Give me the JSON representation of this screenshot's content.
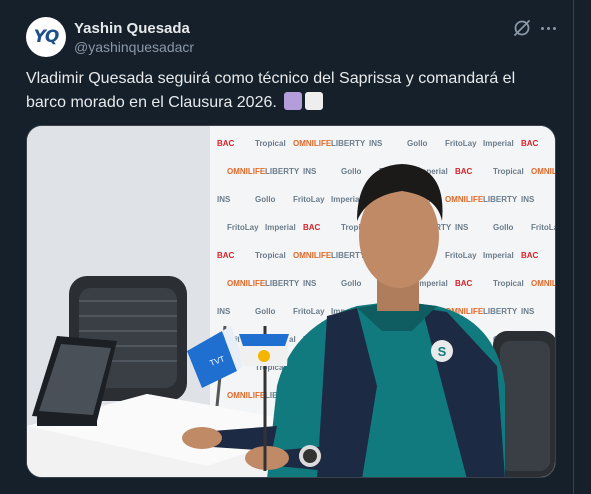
{
  "author": {
    "name": "Yashin Quesada",
    "handle": "@yashinquesadacr",
    "avatar_text": "YQ"
  },
  "actions": {
    "grok_icon": "grok-icon",
    "more_icon": "more-icon"
  },
  "tweet": {
    "text": "Vladimir Quesada seguirá como técnico del Saprissa y comandará el barco morado en el Clausura 2026.",
    "emoji": [
      "purple-square",
      "white-square"
    ]
  },
  "media": {
    "backdrop_sponsors": [
      "BAC",
      "Tropical",
      "OMNILIFE",
      "LIBERTY",
      "INS",
      "Gollo",
      "FritoLay",
      "Imperial"
    ],
    "microphone_brands": [
      "Teletica",
      "Teletica"
    ],
    "colors": {
      "accent_purple": "#b39ddb",
      "jersey_teal": "#117a7e",
      "jersey_navy": "#1d2a44",
      "bac_red": "#d8232a"
    }
  }
}
